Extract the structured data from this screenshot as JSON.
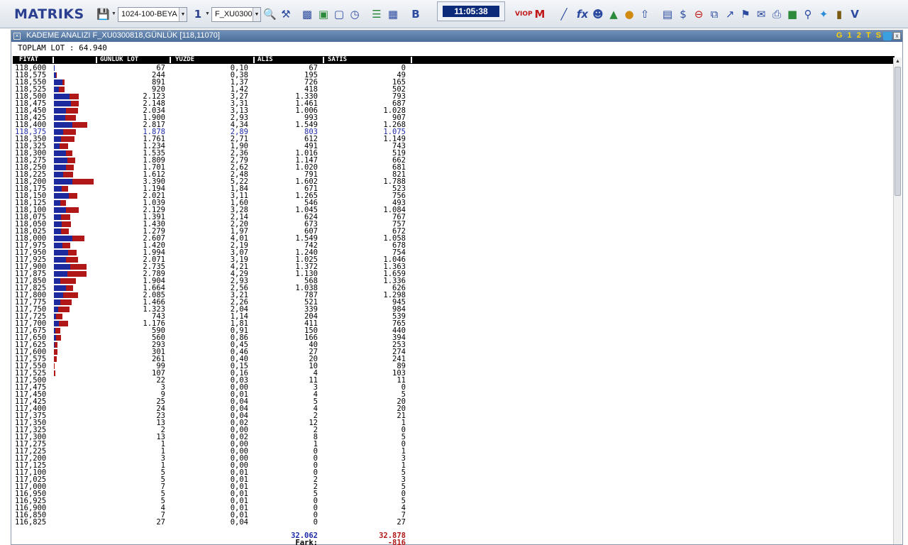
{
  "toolbar": {
    "logo": "MATRIKS",
    "profile_select": "1024-100-BEYA",
    "window_number": "1",
    "symbol_select": "F_XU0300",
    "clock": "11:05:38",
    "icons": [
      "save-icon",
      "search-icon",
      "tools-icon",
      "bar-chart-icon",
      "cube-icon",
      "monitor-icon",
      "clock-icon",
      "list-icon",
      "table-icon",
      "bold-icon",
      "viop-icon",
      "m-icon",
      "line-chart-icon",
      "fx-icon",
      "users-icon",
      "people-chart-icon",
      "traffic-light-icon",
      "upload-icon",
      "document-icon",
      "dollar-icon",
      "remove-icon",
      "new-window-icon",
      "popout-icon",
      "bell-icon",
      "mail-icon",
      "print-icon",
      "chat-icon",
      "zoom-icon",
      "twitter-icon",
      "book-icon",
      "v-icon"
    ],
    "viop_label": "VIOP",
    "bold_label": "B",
    "fx_label": "fx",
    "v_label": "V"
  },
  "window": {
    "title": "KADEME ANALIZI F_XU0300818,GÜNLÜK [118,11070]",
    "badge": "G 1 2 T S",
    "close": "x"
  },
  "summary": {
    "toplam_lot": "TOPLAM LOT : 64.940"
  },
  "table": {
    "headers": {
      "fiyat": "FİYAT",
      "gunluk_lot": "GUNLUK LOT",
      "yuzde": "YUZDE",
      "alis": "ALIS",
      "satis": "SATIS"
    },
    "highlight_price": "118,375",
    "rows": [
      [
        "118,600",
        "67",
        "0,10",
        "67",
        "0"
      ],
      [
        "118,575",
        "244",
        "0,38",
        "195",
        "49"
      ],
      [
        "118,550",
        "891",
        "1,37",
        "726",
        "165"
      ],
      [
        "118,525",
        "920",
        "1,42",
        "418",
        "502"
      ],
      [
        "118,500",
        "2.123",
        "3,27",
        "1.330",
        "793"
      ],
      [
        "118,475",
        "2.148",
        "3,31",
        "1.461",
        "687"
      ],
      [
        "118,450",
        "2.034",
        "3,13",
        "1.006",
        "1.028"
      ],
      [
        "118,425",
        "1.900",
        "2,93",
        "993",
        "907"
      ],
      [
        "118,400",
        "2.817",
        "4,34",
        "1.549",
        "1.268"
      ],
      [
        "118,375",
        "1.878",
        "2,89",
        "803",
        "1.075"
      ],
      [
        "118,350",
        "1.761",
        "2,71",
        "612",
        "1.149"
      ],
      [
        "118,325",
        "1.234",
        "1,90",
        "491",
        "743"
      ],
      [
        "118,300",
        "1.535",
        "2,36",
        "1.016",
        "519"
      ],
      [
        "118,275",
        "1.809",
        "2,79",
        "1.147",
        "662"
      ],
      [
        "118,250",
        "1.701",
        "2,62",
        "1.020",
        "681"
      ],
      [
        "118,225",
        "1.612",
        "2,48",
        "791",
        "821"
      ],
      [
        "118,200",
        "3.390",
        "5,22",
        "1.602",
        "1.788"
      ],
      [
        "118,175",
        "1.194",
        "1,84",
        "671",
        "523"
      ],
      [
        "118,150",
        "2.021",
        "3,11",
        "1.265",
        "756"
      ],
      [
        "118,125",
        "1.039",
        "1,60",
        "546",
        "493"
      ],
      [
        "118,100",
        "2.129",
        "3,28",
        "1.045",
        "1.084"
      ],
      [
        "118,075",
        "1.391",
        "2,14",
        "624",
        "767"
      ],
      [
        "118,050",
        "1.430",
        "2,20",
        "673",
        "757"
      ],
      [
        "118,025",
        "1.279",
        "1,97",
        "607",
        "672"
      ],
      [
        "118,000",
        "2.607",
        "4,01",
        "1.549",
        "1.058"
      ],
      [
        "117,975",
        "1.420",
        "2,19",
        "742",
        "678"
      ],
      [
        "117,950",
        "1.994",
        "3,07",
        "1.240",
        "754"
      ],
      [
        "117,925",
        "2.071",
        "3,19",
        "1.025",
        "1.046"
      ],
      [
        "117,900",
        "2.735",
        "4,21",
        "1.372",
        "1.363"
      ],
      [
        "117,875",
        "2.789",
        "4,29",
        "1.130",
        "1.659"
      ],
      [
        "117,850",
        "1.904",
        "2,93",
        "568",
        "1.336"
      ],
      [
        "117,825",
        "1.664",
        "2,56",
        "1.038",
        "626"
      ],
      [
        "117,800",
        "2.085",
        "3,21",
        "787",
        "1.298"
      ],
      [
        "117,775",
        "1.466",
        "2,26",
        "521",
        "945"
      ],
      [
        "117,750",
        "1.323",
        "2,04",
        "339",
        "984"
      ],
      [
        "117,725",
        "743",
        "1,14",
        "204",
        "539"
      ],
      [
        "117,700",
        "1.176",
        "1,81",
        "411",
        "765"
      ],
      [
        "117,675",
        "590",
        "0,91",
        "150",
        "440"
      ],
      [
        "117,650",
        "560",
        "0,86",
        "166",
        "394"
      ],
      [
        "117,625",
        "293",
        "0,45",
        "40",
        "253"
      ],
      [
        "117,600",
        "301",
        "0,46",
        "27",
        "274"
      ],
      [
        "117,575",
        "261",
        "0,40",
        "20",
        "241"
      ],
      [
        "117,550",
        "99",
        "0,15",
        "10",
        "89"
      ],
      [
        "117,525",
        "107",
        "0,16",
        "4",
        "103"
      ],
      [
        "117,500",
        "22",
        "0,03",
        "11",
        "11"
      ],
      [
        "117,475",
        "3",
        "0,00",
        "3",
        "0"
      ],
      [
        "117,450",
        "9",
        "0,01",
        "4",
        "5"
      ],
      [
        "117,425",
        "25",
        "0,04",
        "5",
        "20"
      ],
      [
        "117,400",
        "24",
        "0,04",
        "4",
        "20"
      ],
      [
        "117,375",
        "23",
        "0,04",
        "2",
        "21"
      ],
      [
        "117,350",
        "13",
        "0,02",
        "12",
        "1"
      ],
      [
        "117,325",
        "2",
        "0,00",
        "2",
        "0"
      ],
      [
        "117,300",
        "13",
        "0,02",
        "8",
        "5"
      ],
      [
        "117,275",
        "1",
        "0,00",
        "1",
        "0"
      ],
      [
        "117,225",
        "1",
        "0,00",
        "0",
        "1"
      ],
      [
        "117,200",
        "3",
        "0,00",
        "0",
        "3"
      ],
      [
        "117,125",
        "1",
        "0,00",
        "0",
        "1"
      ],
      [
        "117,100",
        "5",
        "0,01",
        "0",
        "5"
      ],
      [
        "117,025",
        "5",
        "0,01",
        "2",
        "3"
      ],
      [
        "117,000",
        "7",
        "0,01",
        "2",
        "5"
      ],
      [
        "116,950",
        "5",
        "0,01",
        "5",
        "0"
      ],
      [
        "116,925",
        "5",
        "0,01",
        "0",
        "5"
      ],
      [
        "116,900",
        "4",
        "0,01",
        "0",
        "4"
      ],
      [
        "116,850",
        "7",
        "0,01",
        "0",
        "7"
      ],
      [
        "116,825",
        "27",
        "0,04",
        "0",
        "27"
      ]
    ]
  },
  "totals": {
    "alis": "32.062",
    "satis": "32.878",
    "fark_label": "Fark:",
    "fark": "-816"
  },
  "colors": {
    "buy": "#1c2a9e",
    "sell": "#b01818",
    "title_bar": "#5878a6",
    "badge": "#ffd400"
  }
}
